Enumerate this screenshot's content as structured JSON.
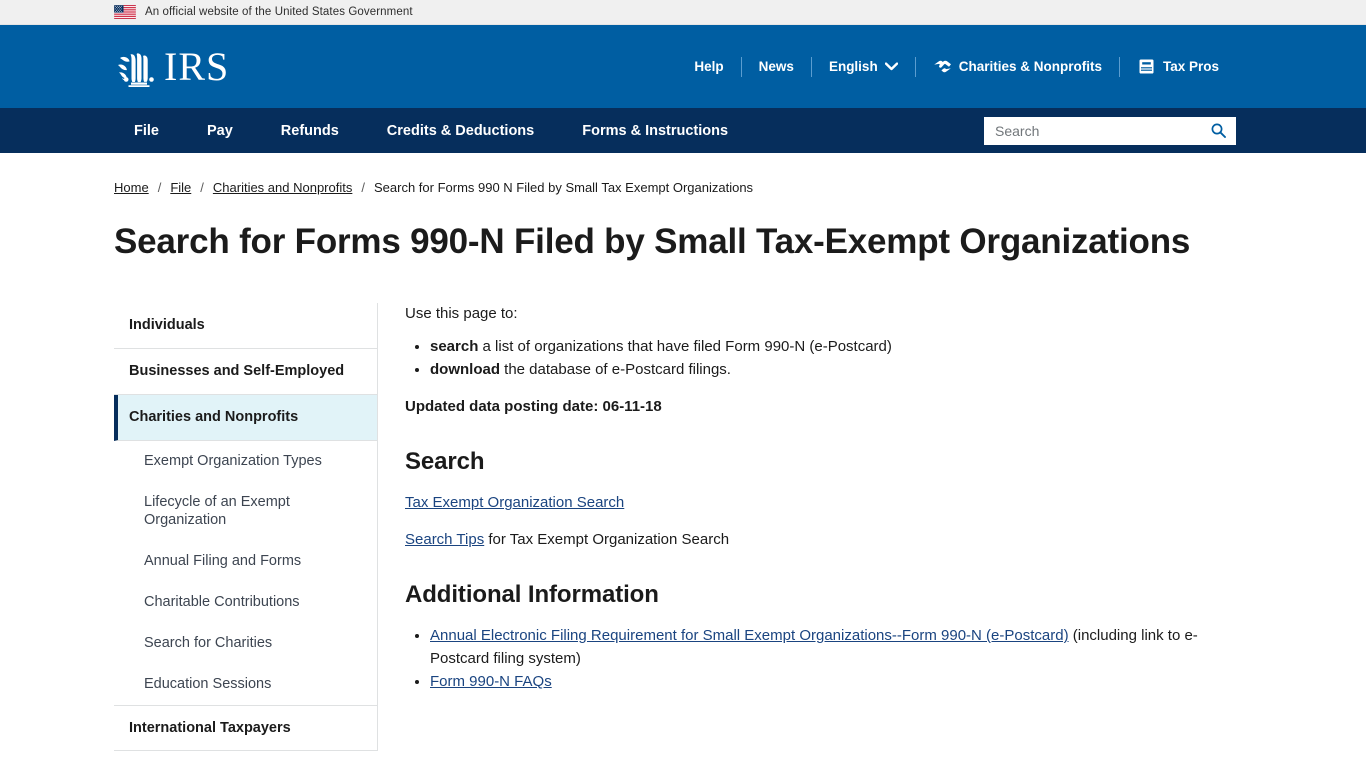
{
  "gov_banner": {
    "text": "An official website of the United States Government",
    "flag_icon": "us-flag-icon"
  },
  "masthead": {
    "logo_text": "IRS",
    "logo_icon": "irs-eagle-seal-icon",
    "utility_nav": [
      {
        "label": "Help",
        "icon": null
      },
      {
        "label": "News",
        "icon": null
      },
      {
        "label": "English",
        "icon": "chevron-down-icon"
      },
      {
        "label": "Charities & Nonprofits",
        "icon": "handshake-icon"
      },
      {
        "label": "Tax Pros",
        "icon": "book-icon"
      }
    ]
  },
  "primary_nav": {
    "items": [
      {
        "label": "File"
      },
      {
        "label": "Pay"
      },
      {
        "label": "Refunds"
      },
      {
        "label": "Credits & Deductions"
      },
      {
        "label": "Forms & Instructions"
      }
    ],
    "search": {
      "placeholder": "Search",
      "value": "",
      "button_icon": "search-icon"
    }
  },
  "breadcrumb": {
    "items": [
      {
        "label": "Home",
        "link": true
      },
      {
        "label": "File",
        "link": true
      },
      {
        "label": "Charities and Nonprofits",
        "link": true
      },
      {
        "label": "Search for Forms 990 N Filed by Small Tax Exempt Organizations",
        "link": false
      }
    ],
    "separator": "/"
  },
  "page_title": "Search for Forms 990-N Filed by Small Tax-Exempt Organizations",
  "sidebar": {
    "items": [
      {
        "label": "Individuals",
        "level": "top",
        "active": false
      },
      {
        "label": "Businesses and Self-Employed",
        "level": "top",
        "active": false
      },
      {
        "label": "Charities and Nonprofits",
        "level": "top",
        "active": true
      },
      {
        "label": "Exempt Organization Types",
        "level": "child",
        "active": false
      },
      {
        "label": "Lifecycle of an Exempt Organization",
        "level": "child",
        "active": false
      },
      {
        "label": "Annual Filing and Forms",
        "level": "child",
        "active": false
      },
      {
        "label": "Charitable Contributions",
        "level": "child",
        "active": false
      },
      {
        "label": "Search for Charities",
        "level": "child",
        "active": false
      },
      {
        "label": "Education Sessions",
        "level": "child",
        "active": false
      },
      {
        "label": "International Taxpayers",
        "level": "top",
        "active": false
      }
    ]
  },
  "content": {
    "intro": "Use this page to:",
    "bullets": [
      {
        "bold": "search",
        "rest": " a list of organizations that have filed Form 990-N (e-Postcard)"
      },
      {
        "bold": "download",
        "rest": " the database of e-Postcard filings."
      }
    ],
    "posting_date": "Updated data posting date: 06-11-18",
    "search_section": {
      "heading": "Search",
      "link1": "Tax Exempt Organization Search",
      "link2": "Search Tips",
      "link2_rest": " for Tax Exempt Organization Search"
    },
    "additional_section": {
      "heading": "Additional Information",
      "items": [
        {
          "link": "Annual Electronic Filing Requirement for Small Exempt Organizations--Form 990-N (e-Postcard)",
          "rest": " (including link to e-Postcard filing system)"
        },
        {
          "link": "Form 990-N FAQs",
          "rest": ""
        }
      ]
    }
  },
  "colors": {
    "masthead_blue": "#005ea2",
    "nav_navy": "#062e5c",
    "active_bg": "#e1f3f8",
    "link_blue": "#1a4480",
    "banner_gray": "#f0f0f0"
  }
}
